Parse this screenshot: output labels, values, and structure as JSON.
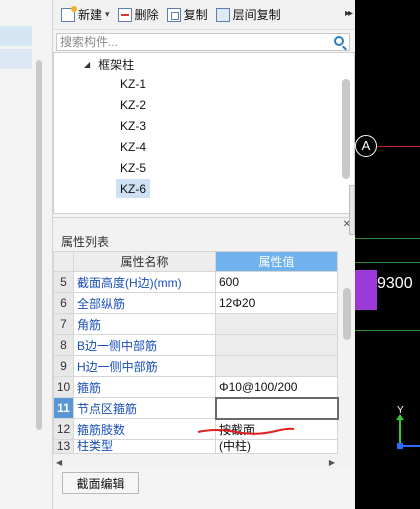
{
  "toolbar": {
    "new_label": "新建",
    "delete_label": "删除",
    "copy_label": "复制",
    "floor_copy_label": "层间复制",
    "more_label": "▸▸"
  },
  "search": {
    "placeholder": "搜索构件..."
  },
  "tree": {
    "root_label": "框架柱",
    "items": [
      "KZ-1",
      "KZ-2",
      "KZ-3",
      "KZ-4",
      "KZ-5",
      "KZ-6"
    ],
    "selected": "KZ-6"
  },
  "properties": {
    "title": "属性列表",
    "columns": {
      "name": "属性名称",
      "value": "属性值"
    },
    "rows": [
      {
        "num": "5",
        "name": "截面高度(H边)(mm)",
        "value": "600"
      },
      {
        "num": "6",
        "name": "全部纵筋",
        "value": "12Φ20"
      },
      {
        "num": "7",
        "name": "角筋",
        "value": ""
      },
      {
        "num": "8",
        "name": "B边一侧中部筋",
        "value": ""
      },
      {
        "num": "9",
        "name": "H边一侧中部筋",
        "value": ""
      },
      {
        "num": "10",
        "name": "箍筋",
        "value": "Φ10@100/200"
      },
      {
        "num": "11",
        "name": "节点区箍筋",
        "value": ""
      },
      {
        "num": "12",
        "name": "箍筋肢数",
        "value": "按截面"
      },
      {
        "num": "13",
        "name": "柱类型",
        "value": "(中柱)"
      }
    ],
    "selected_row": "11"
  },
  "buttons": {
    "section_edit": "截面编辑"
  },
  "canvas": {
    "axis_label": "A",
    "dimension": "9300",
    "ucs_y": "Y"
  },
  "colors": {
    "header_accent": "#6fb2ee",
    "selected_row": "#5a96d6",
    "property_name": "#1a4fb8",
    "annotation_red": "#e02020",
    "column_purple": "#9b3ad6"
  }
}
